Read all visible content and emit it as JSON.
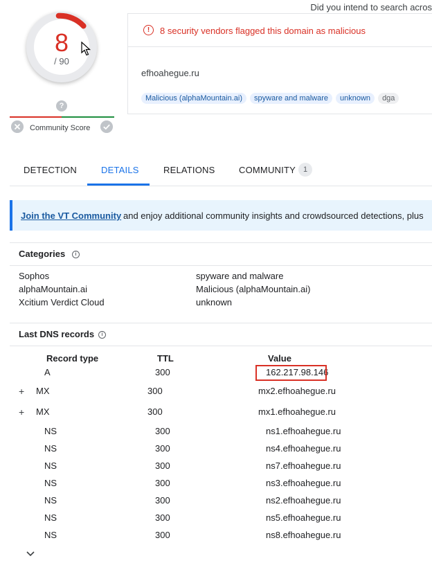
{
  "top_hint": "Did you intend to search acros",
  "score": {
    "value": "8",
    "total": "/ 90"
  },
  "community": {
    "label": "Community Score",
    "question": "?"
  },
  "alert": {
    "text": "8 security vendors flagged this domain as malicious",
    "icon": "!"
  },
  "domain": "efhoahegue.ru",
  "tags": [
    "Malicious (alphaMountain.ai)",
    "spyware and malware",
    "unknown",
    "dga"
  ],
  "tabs": [
    {
      "label": "DETECTION"
    },
    {
      "label": "DETAILS"
    },
    {
      "label": "RELATIONS"
    },
    {
      "label": "COMMUNITY",
      "count": "1"
    }
  ],
  "banner": {
    "link": "Join the VT Community",
    "text": "and enjoy additional community insights and crowdsourced detections, plus"
  },
  "categories": {
    "title": "Categories",
    "rows": [
      {
        "vendor": "Sophos",
        "value": "spyware and malware"
      },
      {
        "vendor": "alphaMountain.ai",
        "value": "Malicious (alphaMountain.ai)"
      },
      {
        "vendor": "Xcitium Verdict Cloud",
        "value": "unknown"
      }
    ]
  },
  "dns": {
    "title": "Last DNS records",
    "headers": {
      "type": "Record type",
      "ttl": "TTL",
      "value": "Value"
    },
    "rows": [
      {
        "type": "A",
        "ttl": "300",
        "value": "162.217.98.146"
      },
      {
        "type": "MX",
        "ttl": "300",
        "value": "mx2.efhoahegue.ru",
        "expand": "+"
      },
      {
        "type": "MX",
        "ttl": "300",
        "value": "mx1.efhoahegue.ru",
        "expand": "+"
      },
      {
        "type": "NS",
        "ttl": "300",
        "value": "ns1.efhoahegue.ru"
      },
      {
        "type": "NS",
        "ttl": "300",
        "value": "ns4.efhoahegue.ru"
      },
      {
        "type": "NS",
        "ttl": "300",
        "value": "ns7.efhoahegue.ru"
      },
      {
        "type": "NS",
        "ttl": "300",
        "value": "ns3.efhoahegue.ru"
      },
      {
        "type": "NS",
        "ttl": "300",
        "value": "ns2.efhoahegue.ru"
      },
      {
        "type": "NS",
        "ttl": "300",
        "value": "ns5.efhoahegue.ru"
      },
      {
        "type": "NS",
        "ttl": "300",
        "value": "ns8.efhoahegue.ru"
      }
    ]
  },
  "colors": {
    "malicious": "#d93025",
    "accent": "#1a73e8",
    "clean": "#1e8e3e"
  },
  "icons": [
    "cursor-icon",
    "alert-icon",
    "close-icon",
    "check-icon",
    "info-icon",
    "plus-icon",
    "chevron-down-icon"
  ]
}
